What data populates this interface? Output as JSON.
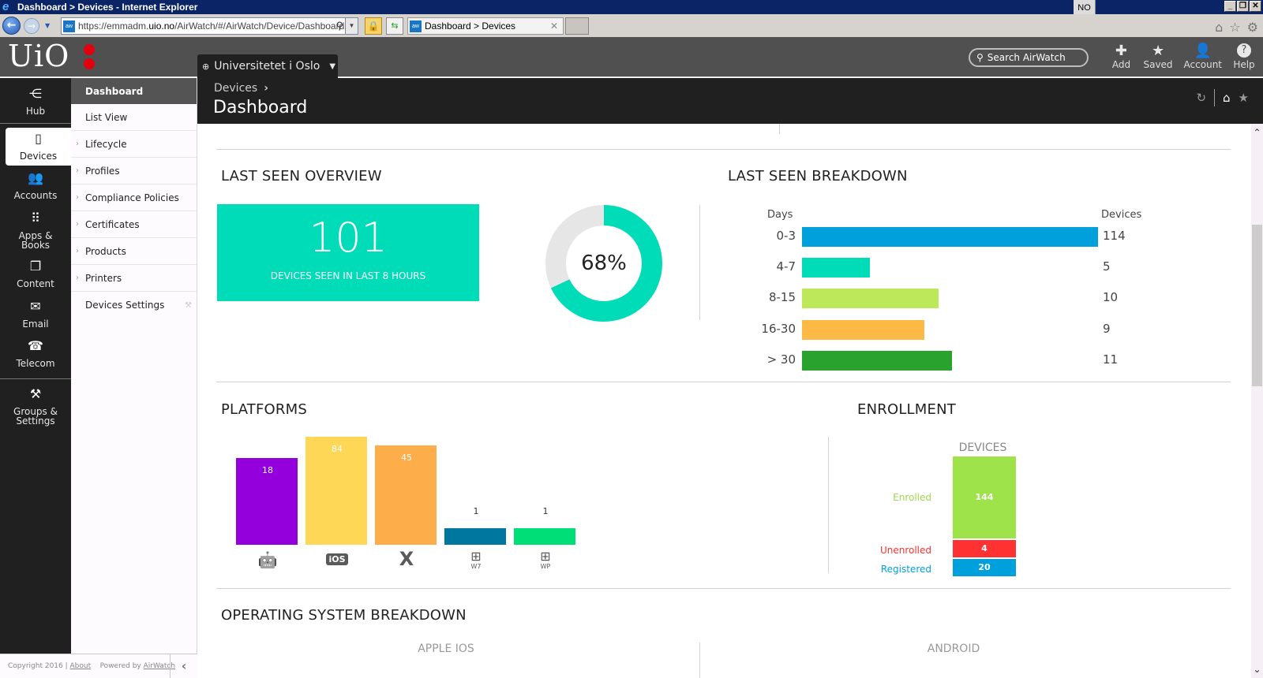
{
  "browser": {
    "window_title": "Dashboard > Devices - Internet Explorer",
    "language_indicator": "NO",
    "url_prefix": "https://emmadm.",
    "url_host": "uio.no",
    "url_path": "/AirWatch/#/AirWatch/Device/Dashboard",
    "tab_title": "Dashboard > Devices",
    "favicon_text": "aw"
  },
  "header": {
    "logo_text": "UiO",
    "org_selector": "Universitetet i Oslo",
    "search_placeholder": "Search AirWatch",
    "actions": [
      {
        "label": "Add",
        "icon": "plus-icon"
      },
      {
        "label": "Saved",
        "icon": "star-icon"
      },
      {
        "label": "Account",
        "icon": "user-icon"
      },
      {
        "label": "Help",
        "icon": "help-icon"
      }
    ]
  },
  "rail": {
    "items": [
      {
        "label": "Hub",
        "icon": "hub-icon"
      },
      {
        "label": "Devices",
        "icon": "device-icon",
        "active": true
      },
      {
        "label": "Accounts",
        "icon": "accounts-icon"
      },
      {
        "label": "Apps &",
        "label2": "Books",
        "icon": "apps-grid-icon"
      },
      {
        "label": "Content",
        "icon": "content-icon"
      },
      {
        "label": "Email",
        "icon": "email-icon"
      },
      {
        "label": "Telecom",
        "icon": "telephone-icon"
      },
      {
        "label": "Groups &",
        "label2": "Settings",
        "icon": "tools-icon"
      }
    ]
  },
  "subnav": {
    "items": [
      {
        "label": "Dashboard",
        "active": true,
        "expandable": false
      },
      {
        "label": "List View",
        "expandable": false
      },
      {
        "label": "Lifecycle",
        "expandable": true
      },
      {
        "label": "Profiles",
        "expandable": true
      },
      {
        "label": "Compliance Policies",
        "expandable": true
      },
      {
        "label": "Certificates",
        "expandable": true
      },
      {
        "label": "Products",
        "expandable": true
      },
      {
        "label": "Printers",
        "expandable": true
      },
      {
        "label": "Devices Settings",
        "expandable": false
      }
    ]
  },
  "footer": {
    "copyright": "Copyright 2016 |",
    "about": "About",
    "powered_by": "Powered by",
    "airwatch": "AirWatch"
  },
  "page": {
    "breadcrumb": "Devices",
    "title": "Dashboard"
  },
  "last_seen_overview": {
    "title": "LAST SEEN OVERVIEW",
    "count": "101",
    "count_label": "DEVICES SEEN IN LAST 8 HOURS",
    "percent_label": "68%",
    "percent": 68,
    "colors": {
      "fill": "#00dbb8",
      "track": "#e6e6e6"
    }
  },
  "last_seen_breakdown": {
    "title": "LAST SEEN BREAKDOWN",
    "col_days": "Days",
    "col_devices": "Devices",
    "rows": [
      {
        "days": "0-3",
        "devices": 114,
        "color": "#00a0dc"
      },
      {
        "days": "4-7",
        "devices": 5,
        "color": "#00dbb8"
      },
      {
        "days": "8-15",
        "devices": 10,
        "color": "#bde85a"
      },
      {
        "days": "16-30",
        "devices": 9,
        "color": "#fdb946"
      },
      {
        "days": "> 30",
        "devices": 11,
        "color": "#29a32e"
      }
    ]
  },
  "platforms": {
    "title": "PLATFORMS",
    "bars": [
      {
        "platform": "Android",
        "value": 18,
        "color": "#9300dc",
        "icon": "android-icon",
        "icon_label": ""
      },
      {
        "platform": "iOS",
        "value": 84,
        "color": "#fed757",
        "icon": "ios-icon",
        "icon_label": "iOS"
      },
      {
        "platform": "macOS",
        "value": 45,
        "color": "#fead4b",
        "icon": "osx-icon",
        "icon_label": "X"
      },
      {
        "platform": "Windows 7",
        "value": 1,
        "color": "#00779e",
        "icon": "windows7-icon",
        "icon_label": "W7"
      },
      {
        "platform": "Windows Phone",
        "value": 1,
        "color": "#00de77",
        "icon": "windows-phone-icon",
        "icon_label": "WP"
      }
    ]
  },
  "enrollment": {
    "title": "ENROLLMENT",
    "column_label": "DEVICES",
    "segments": [
      {
        "label": "Enrolled",
        "value": 144,
        "color": "#9fe34a"
      },
      {
        "label": "Unenrolled",
        "value": 4,
        "color": "#ff3131"
      },
      {
        "label": "Registered",
        "value": 20,
        "color": "#00a0dc"
      }
    ]
  },
  "os_breakdown": {
    "title": "OPERATING SYSTEM BREAKDOWN",
    "columns": [
      "APPLE IOS",
      "ANDROID"
    ]
  }
}
